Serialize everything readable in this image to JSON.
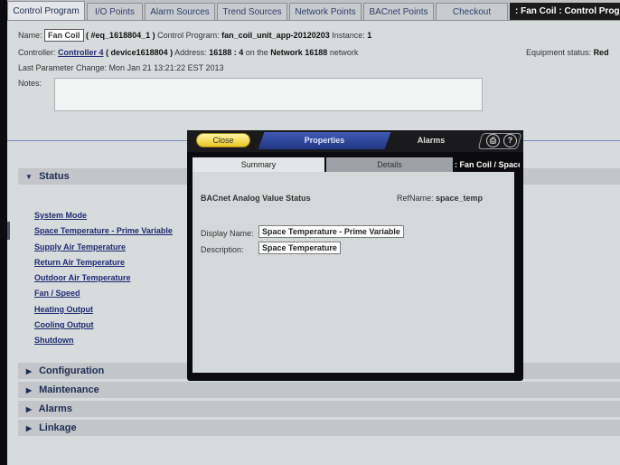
{
  "tabs": [
    {
      "label": "Control Program",
      "active": true
    },
    {
      "label": "I/O Points"
    },
    {
      "label": "Alarm Sources"
    },
    {
      "label": "Trend Sources"
    },
    {
      "label": "Network Points"
    },
    {
      "label": "BACnet Points"
    },
    {
      "label": "Checkout"
    }
  ],
  "window_title": ": Fan Coil : Control Program",
  "info": {
    "name_label": "Name:",
    "name_value": "Fan Coil",
    "eq_id": "( #eq_1618804_1 )",
    "control_program_label": "Control Program:",
    "control_program_value": "fan_coil_unit_app-20120203",
    "instance_label": "Instance:",
    "instance_value": "1",
    "controller_label": "Controller:",
    "controller_value": "Controller 4",
    "device_value": "( device1618804 )",
    "address_label": "Address:",
    "address_value": "16188 : 4",
    "on_the": "on the",
    "network_value": "Network 16188",
    "network_suffix": "network",
    "equipment_status_label": "Equipment status:",
    "equipment_status_value": "Red",
    "last_change": "Last Parameter Change:  Mon Jan 21 13:21:22 EST 2013",
    "notes_label": "Notes:"
  },
  "sections": {
    "status": "Status",
    "configuration": "Configuration",
    "maintenance": "Maintenance",
    "alarms": "Alarms",
    "linkage": "Linkage"
  },
  "status_items": [
    "System Mode",
    "Space Temperature - Prime Variable",
    "Supply Air Temperature",
    "Return Air Temperature",
    "Outdoor Air Temperature",
    "Fan / Speed",
    "Heating Output",
    "Cooling Output",
    "Shutdown"
  ],
  "dialog": {
    "close": "Close",
    "properties": "Properties",
    "alarms": "Alarms",
    "tab_summary": "Summary",
    "tab_details": "Details",
    "title": ": Fan Coil / Space Temperature",
    "heading": "BACnet Analog Value Status",
    "refname_label": "RefName:",
    "refname_value": "space_temp",
    "display_name_label": "Display Name:",
    "display_name_value": "Space Temperature - Prime Variable",
    "description_label": "Description:",
    "description_value": "Space Temperature"
  },
  "icons": [
    "print-icon",
    "help-icon",
    "chevron-down-icon",
    "chevron-right-icon"
  ],
  "colors": {
    "accent": "#1d2a73",
    "close_button": "#f2d94a",
    "properties_tab": "#2f4aa0"
  }
}
